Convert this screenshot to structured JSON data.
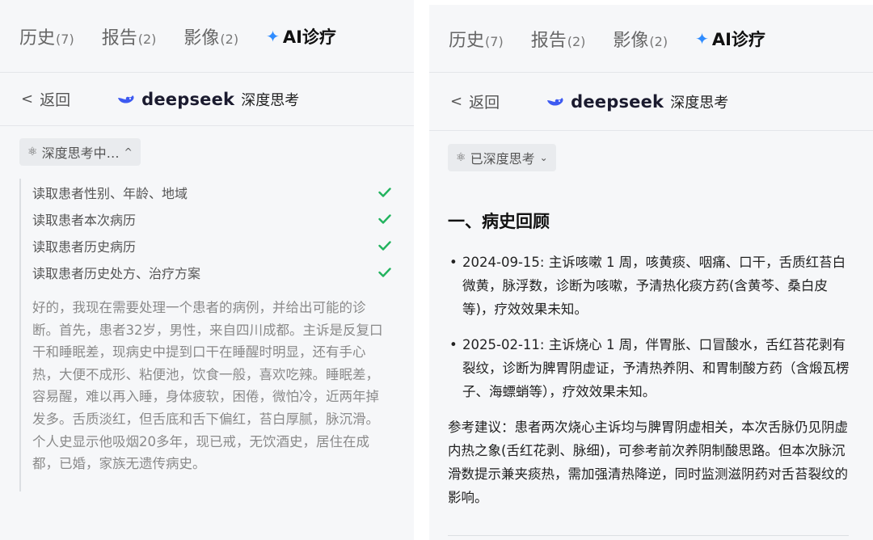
{
  "tabs": [
    {
      "label": "历史",
      "count": "(7)"
    },
    {
      "label": "报告",
      "count": "(2)"
    },
    {
      "label": "影像",
      "count": "(2)"
    },
    {
      "label": "AI诊疗",
      "count": ""
    }
  ],
  "subbar": {
    "back_label": "返回",
    "brand": "deepseek",
    "mode": "深度思考"
  },
  "left": {
    "pill_label": "深度思考中…",
    "steps": [
      "读取患者性别、年龄、地域",
      "读取患者本次病历",
      "读取患者历史病历",
      "读取患者历史处方、治疗方案"
    ],
    "thinking": "好的，我现在需要处理一个患者的病例，并给出可能的诊断。首先，患者32岁，男性，来自四川成都。主诉是反复口干和睡眠差，现病史中提到口干在睡醒时明显，还有手心热，大便不成形、粘便池，饮食一般，喜欢吃辣。睡眠差，容易醒，难以再入睡，身体疲软，困倦，微怕冷，近两年掉发多。舌质淡红，但舌底和舌下偏红，苔白厚腻，脉沉滑。个人史显示他吸烟20多年，现已戒，无饮酒史，居住在成都，已婚，家族无遗传病史。"
  },
  "right": {
    "pill_label": "已深度思考",
    "heading": "一、病史回顾",
    "history": [
      "2024-09-15: 主诉咳嗽 1 周，咳黄痰、咽痛、口干，舌质红苔白微黄，脉浮数，诊断为咳嗽，予清热化痰方药(含黄芩、桑白皮等)，疗效效果未知。",
      "2025-02-11: 主诉烧心 1 周，伴胃胀、口冒酸水，舌红苔花剥有裂纹，诊断为脾胃阴虚证，予清热养阴、和胃制酸方药（含煅瓦楞子、海螵蛸等），疗效效果未知。"
    ],
    "advice": "参考建议：患者两次烧心主诉均与脾胃阴虚相关，本次舌脉仍见阴虚内热之象(舌红花剥、脉细)，可参考前次养阴制酸思路。但本次脉沉滑数提示兼夹痰热，需加强清热降逆，同时监测滋阴药对舌苔裂纹的影响。"
  },
  "colors": {
    "accent": "#2f8cff",
    "check": "#22b35e",
    "background": "#f6f7f9"
  },
  "icons": {
    "sparkle": "sparkle-icon",
    "back": "chevron-left-icon",
    "brand": "deepseek-whale-icon",
    "think": "atom-icon",
    "check": "check-icon"
  }
}
